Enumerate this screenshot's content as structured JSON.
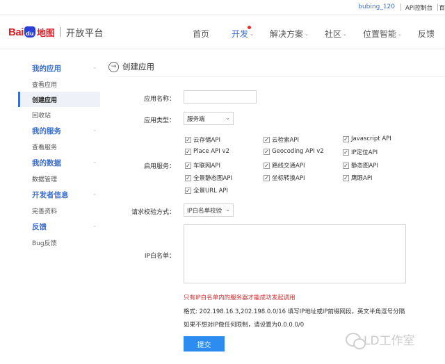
{
  "topbar": {
    "username": "bubing_120",
    "console_label": "API控制台",
    "more_label": "百"
  },
  "header": {
    "logo_bai": "Bai",
    "logo_du": "du",
    "logo_map": "地图",
    "logo_platform": "开放平台",
    "nav": [
      {
        "label": "首页",
        "active": false
      },
      {
        "label": "开发",
        "active": true
      },
      {
        "label": "解决方案",
        "active": false
      },
      {
        "label": "社区",
        "active": false
      },
      {
        "label": "位置智能",
        "active": false
      },
      {
        "label": "反馈",
        "active": false
      }
    ]
  },
  "sidebar": {
    "groups": [
      {
        "title": "我的应用",
        "items": [
          "查看应用",
          "创建应用",
          "回收站"
        ]
      },
      {
        "title": "我的服务",
        "items": [
          "查看服务"
        ]
      },
      {
        "title": "我的数据",
        "items": [
          "数据管理"
        ]
      },
      {
        "title": "开发者信息",
        "items": [
          "完善资料"
        ]
      },
      {
        "title": "反馈",
        "items": [
          "Bug反馈"
        ]
      }
    ],
    "active_item": "创建应用"
  },
  "panel": {
    "title": "创建应用"
  },
  "form": {
    "app_name_label": "应用名称：",
    "app_name_value": "",
    "app_type_label": "应用类型：",
    "app_type_value": "服务端",
    "services_label": "启用服务：",
    "services": [
      {
        "label": "云存储API",
        "checked": true
      },
      {
        "label": "云检索API",
        "checked": true
      },
      {
        "label": "Javascript API",
        "checked": true
      },
      {
        "label": "Place API v2",
        "checked": true
      },
      {
        "label": "Geocoding API v2",
        "checked": true
      },
      {
        "label": "IP定位API",
        "checked": true
      },
      {
        "label": "车联网API",
        "checked": true
      },
      {
        "label": "路线交通API",
        "checked": true
      },
      {
        "label": "静态图API",
        "checked": true
      },
      {
        "label": "全景静态图API",
        "checked": true
      },
      {
        "label": "坐标转换API",
        "checked": true
      },
      {
        "label": "鹰眼API",
        "checked": true
      },
      {
        "label": "全景URL API",
        "checked": true
      }
    ],
    "verify_label": "请求校验方式：",
    "verify_value": "IP白名单校验",
    "whitelist_label": "IP白名单：",
    "whitelist_value": "",
    "warning": "只有IP白名单内的服务器才能成功发起调用",
    "hint1": "格式: 202.198.16.3,202.198.0.0/16 填写IP地址或IP前缀网段，英文半角逗号分隔",
    "hint2": "如果不想对IP做任何限制，请设置为0.0.0.0/0",
    "submit_label": "提交"
  },
  "watermark": {
    "text": "LD工作室"
  }
}
